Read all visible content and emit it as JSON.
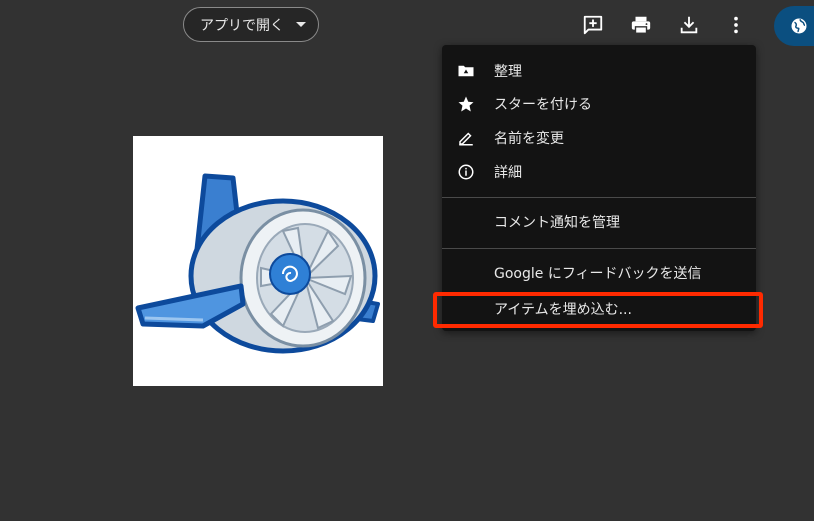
{
  "toolbar": {
    "open_with_label": "アプリで開く",
    "icons": [
      "add-comment-icon",
      "print-icon",
      "download-icon",
      "more-vert-icon",
      "globe-icon"
    ]
  },
  "preview": {
    "icon": "app-engine-logo"
  },
  "menu": {
    "items": [
      {
        "label": "整理",
        "icon": "folder-move-icon"
      },
      {
        "label": "スターを付ける",
        "icon": "star-icon"
      },
      {
        "label": "名前を変更",
        "icon": "rename-pencil-icon"
      },
      {
        "label": "詳細",
        "icon": "info-icon"
      },
      {
        "label": "コメント通知を管理",
        "icon": ""
      },
      {
        "label": "Google にフィードバックを送信",
        "icon": ""
      },
      {
        "label": "アイテムを埋め込む...",
        "icon": ""
      }
    ]
  },
  "colors": {
    "background": "#323232",
    "menu_bg": "#131313",
    "highlight": "#ff2a00",
    "globe_btn": "#0b4f80"
  }
}
